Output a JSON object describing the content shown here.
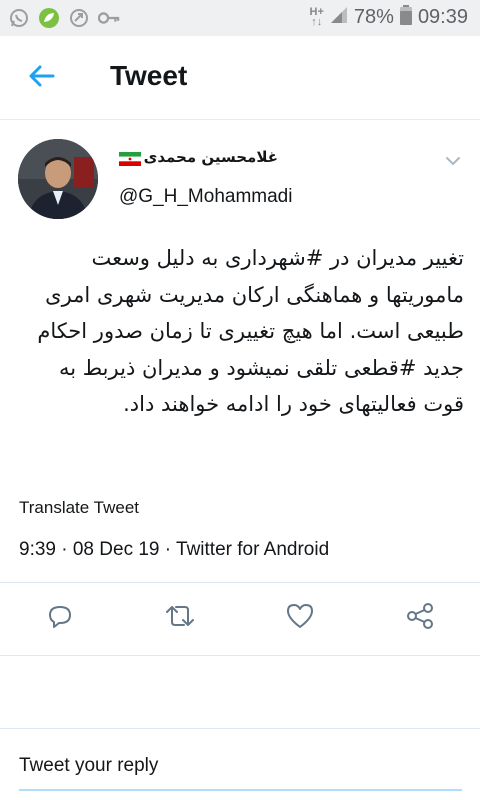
{
  "status_bar": {
    "battery": "78%",
    "time": "09:39",
    "network": "H+",
    "icons": [
      "whatsapp-icon",
      "leaf-icon",
      "missed-call-icon",
      "key-icon",
      "signal-icon",
      "battery-icon"
    ]
  },
  "header": {
    "title": "Tweet",
    "back_icon": "arrow-left-icon",
    "accent": "#1da1f2"
  },
  "tweet": {
    "display_name": "غلامحسین محمدی",
    "flag_icon": "iran-flag-icon",
    "handle": "@G_H_Mohammadi",
    "text": "تغییر مدیران در #شهرداری به دلیل وسعت ماموریتها و هماهنگی ارکان مدیریت شهری امری طبیعی است. اما هیچ تغییری تا زمان صدور احکام جدید #قطعی تلقی نمیشود و مدیران ذیربط به قوت فعالیتهای خود را ادامه خواهند داد.",
    "translate_label": "Translate Tweet",
    "meta": "9:39 · 08 Dec 19 · Twitter for Android"
  },
  "actions": {
    "icons": [
      "reply-icon",
      "retweet-icon",
      "like-icon",
      "share-icon"
    ],
    "color": "#657786"
  },
  "reply": {
    "placeholder": "Tweet your reply"
  }
}
